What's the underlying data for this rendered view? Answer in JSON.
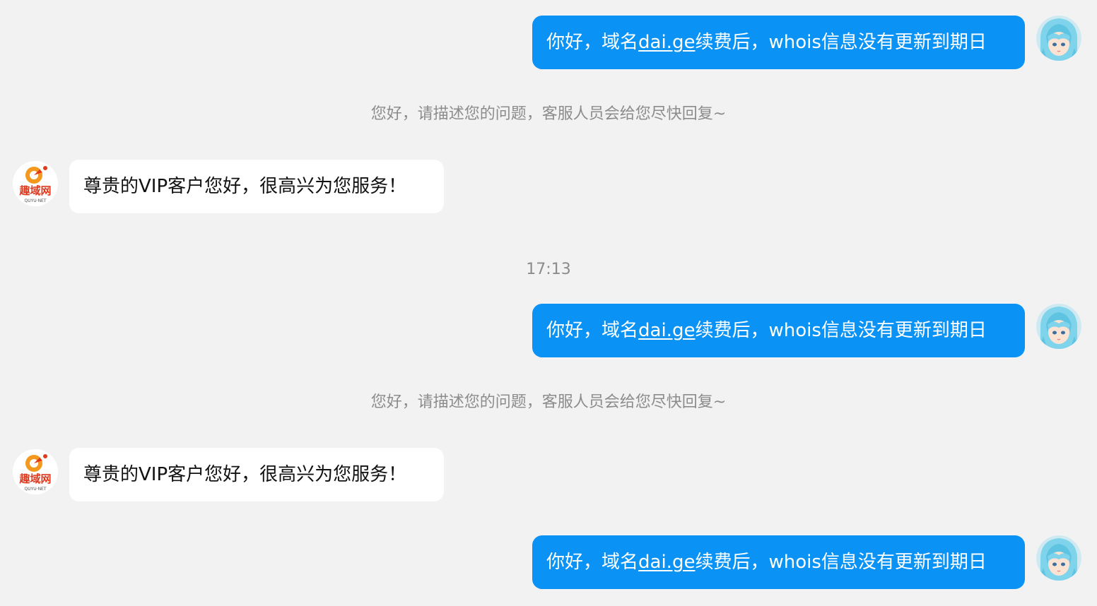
{
  "conversation": {
    "messages": [
      {
        "kind": "outgoing",
        "pre": "你好，域名",
        "link": "dai.ge",
        "post": "续费后，whois信息没有更新到期日"
      },
      {
        "kind": "system",
        "text": "您好，请描述您的问题，客服人员会给您尽快回复~"
      },
      {
        "kind": "incoming",
        "text": "尊贵的VIP客户您好，很高兴为您服务！"
      },
      {
        "kind": "timestamp",
        "text": "17:13"
      },
      {
        "kind": "outgoing",
        "pre": "你好，域名",
        "link": "dai.ge",
        "post": "续费后，whois信息没有更新到期日"
      },
      {
        "kind": "system",
        "text": "您好，请描述您的问题，客服人员会给您尽快回复~"
      },
      {
        "kind": "incoming",
        "text": "尊贵的VIP客户您好，很高兴为您服务！"
      },
      {
        "kind": "outgoing",
        "pre": "你好，域名",
        "link": "dai.ge",
        "post": "续费后，whois信息没有更新到期日"
      }
    ]
  },
  "bot_logo": {
    "brand_text": "趣域网",
    "sub_text": "QUYU·NET"
  },
  "colors": {
    "outgoing_bubble": "#0a93f5",
    "incoming_bubble": "#ffffff",
    "background": "#f2f2f2",
    "system_text": "#8c8c8c",
    "logo_orange": "#f39a1e",
    "logo_red": "#e03a1e"
  },
  "icons": {
    "user_avatar": "anime-avatar-icon",
    "bot_avatar": "quyu-logo-icon"
  }
}
